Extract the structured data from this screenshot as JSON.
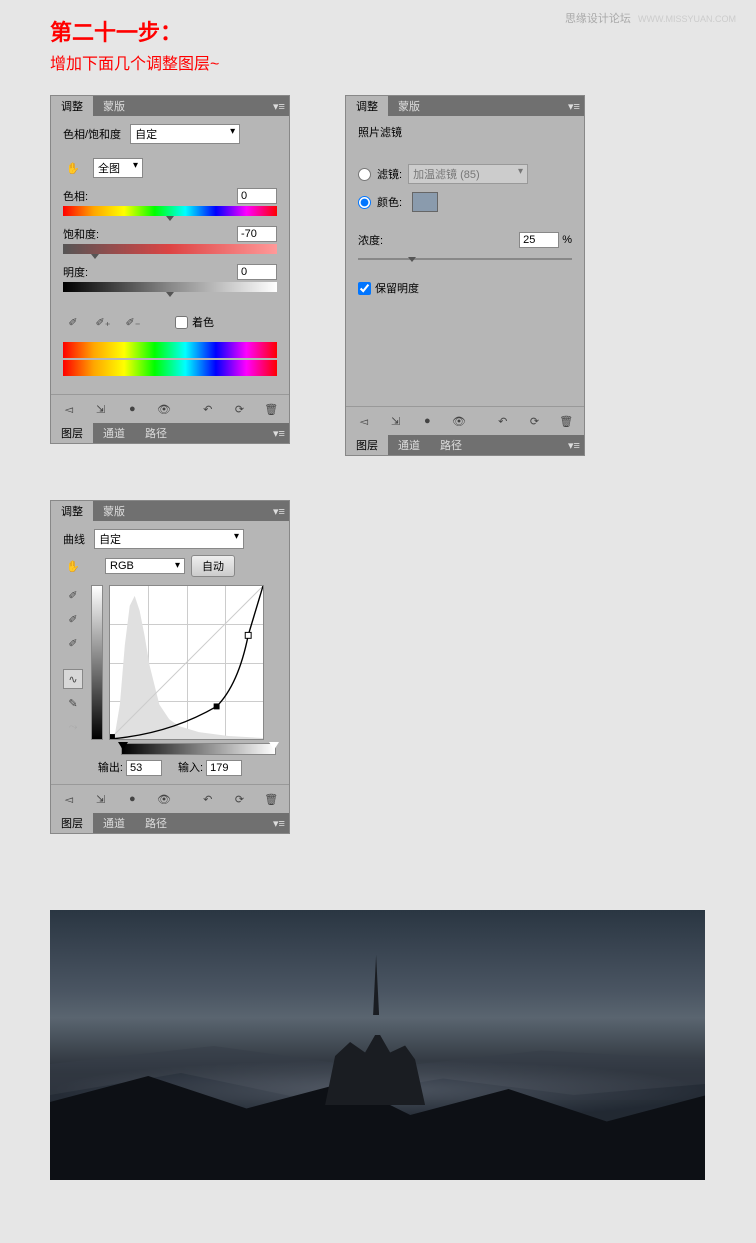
{
  "watermark": {
    "text": "思缘设计论坛",
    "url": "WWW.MISSYUAN.COM"
  },
  "header": {
    "title": "第二十一步：",
    "subtitle": "增加下面几个调整图层~"
  },
  "tabs": {
    "adjust": "调整",
    "mask": "蒙版",
    "layers": "图层",
    "channels": "通道",
    "paths": "路径"
  },
  "hueSat": {
    "title": "色相/饱和度",
    "preset": "自定",
    "scope": "全图",
    "hueLabel": "色相:",
    "hueValue": "0",
    "satLabel": "饱和度:",
    "satValue": "-70",
    "brightLabel": "明度:",
    "brightValue": "0",
    "colorizeLabel": "着色"
  },
  "photoFilter": {
    "title": "照片滤镜",
    "filterLabel": "滤镜:",
    "filterValue": "加温滤镜 (85)",
    "colorLabel": "颜色:",
    "colorSwatch": "#8a9bad",
    "densityLabel": "浓度:",
    "densityValue": "25",
    "densityUnit": "%",
    "preserveLabel": "保留明度"
  },
  "curves": {
    "title": "曲线",
    "preset": "自定",
    "channel": "RGB",
    "autoLabel": "自动",
    "outputLabel": "输出:",
    "outputValue": "53",
    "inputLabel": "输入:",
    "inputValue": "179"
  }
}
